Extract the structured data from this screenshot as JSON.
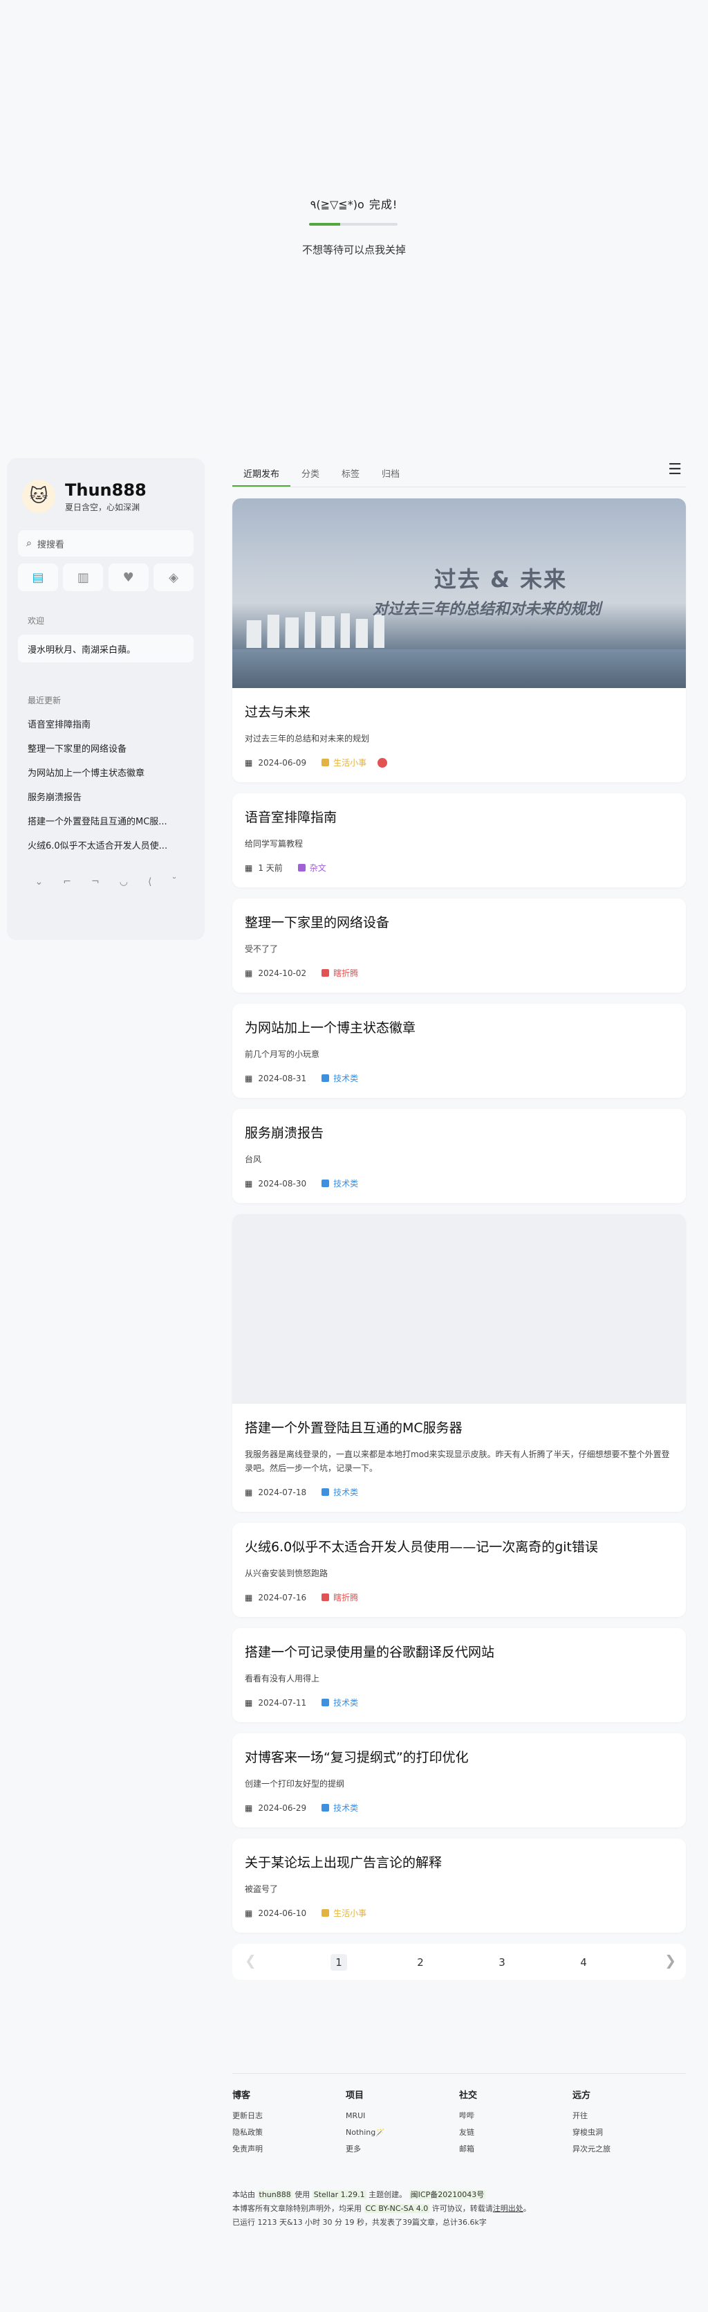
{
  "loader": {
    "text": "٩(≧▽≦*)o 完成!",
    "progress": 0.35,
    "hint": "不想等待可以点我关掉"
  },
  "sidebar": {
    "name": "Thun888",
    "subtitle": "夏日含空，心如深渊",
    "search_placeholder": "搜搜看",
    "welcome_label": "欢迎",
    "welcome_text": "漫水明秋月、南湖采白蘋。",
    "recent_label": "最近更新",
    "recent_items": [
      "语音室排障指南",
      "整理一下家里的网络设备",
      "为网站加上一个博主状态徽章",
      "服务崩溃报告",
      "搭建一个外置登陆且互通的MC服...",
      "火绒6.0似乎不太适合开发人员使..."
    ]
  },
  "tabs": [
    "近期发布",
    "分类",
    "标签",
    "归档"
  ],
  "cover": {
    "title": "过去 & 未来",
    "subtitle": "对过去三年的总结和对未来的规划"
  },
  "posts": [
    {
      "title": "过去与未来",
      "desc": "对过去三年的总结和对未来的规划",
      "date": "2024-06-09",
      "category": "生活小事",
      "cat_color": "#e3b341"
    },
    {
      "title": "语音室排障指南",
      "desc": "给同学写篇教程",
      "date": "1 天前",
      "category": "杂文",
      "cat_color": "#a060d6"
    },
    {
      "title": "整理一下家里的网络设备",
      "desc": "受不了了",
      "date": "2024-10-02",
      "category": "瞎折腾",
      "cat_color": "#e35252"
    },
    {
      "title": "为网站加上一个博主状态徽章",
      "desc": "前几个月写的小玩意",
      "date": "2024-08-31",
      "category": "技术类",
      "cat_color": "#3d8fe0"
    },
    {
      "title": "服务崩溃报告",
      "desc": "台风",
      "date": "2024-08-30",
      "category": "技术类",
      "cat_color": "#3d8fe0"
    },
    {
      "title": "搭建一个外置登陆且互通的MC服务器",
      "desc": "我服务器是离线登录的，一直以来都是本地打mod来实现显示皮肤。昨天有人折腾了半天，仔细想想要不整个外置登录吧。然后一步一个坑，记录一下。",
      "date": "2024-07-18",
      "category": "技术类",
      "cat_color": "#3d8fe0"
    },
    {
      "title": "火绒6.0似乎不太适合开发人员使用——记一次离奇的git错误",
      "desc": "从兴奋安装到愤怒跑路",
      "date": "2024-07-16",
      "category": "瞎折腾",
      "cat_color": "#e35252"
    },
    {
      "title": "搭建一个可记录使用量的谷歌翻译反代网站",
      "desc": "看看有没有人用得上",
      "date": "2024-07-11",
      "category": "技术类",
      "cat_color": "#3d8fe0"
    },
    {
      "title": "对博客来一场“复习提纲式”的打印优化",
      "desc": "创建一个打印友好型的提纲",
      "date": "2024-06-29",
      "category": "技术类",
      "cat_color": "#3d8fe0"
    },
    {
      "title": "关于某论坛上出现广告言论的解释",
      "desc": "被盗号了",
      "date": "2024-06-10",
      "category": "生活小事",
      "cat_color": "#e3b341"
    }
  ],
  "pager": {
    "pages": [
      "1",
      "2",
      "3",
      "4"
    ],
    "current": "1"
  },
  "footer": {
    "cols": [
      {
        "title": "博客",
        "links": [
          "更新日志",
          "隐私政策",
          "免责声明"
        ]
      },
      {
        "title": "项目",
        "links": [
          "MRUI",
          "Nothing🪄",
          "更多"
        ]
      },
      {
        "title": "社交",
        "links": [
          "哔哔",
          "友链",
          "邮箱"
        ]
      },
      {
        "title": "远方",
        "links": [
          "开往",
          "穿梭虫洞",
          "异次元之旅"
        ]
      }
    ],
    "line1_a": "本站由",
    "line1_owner": "thun888",
    "line1_b": "使用",
    "line1_theme": "Stellar 1.29.1",
    "line1_c": "主题创建。",
    "line1_icp": "闽ICP备20210043号",
    "line2_a": "本博客所有文章除特别声明外，均采用",
    "line2_license": "CC BY-NC-SA 4.0",
    "line2_b": "许可协议，转载请",
    "line2_link": "注明出处",
    "line2_c": "。",
    "line3": "已运行 1213 天&13 小时 30 分 19 秒，共发表了39篇文章，总计36.6k字"
  }
}
